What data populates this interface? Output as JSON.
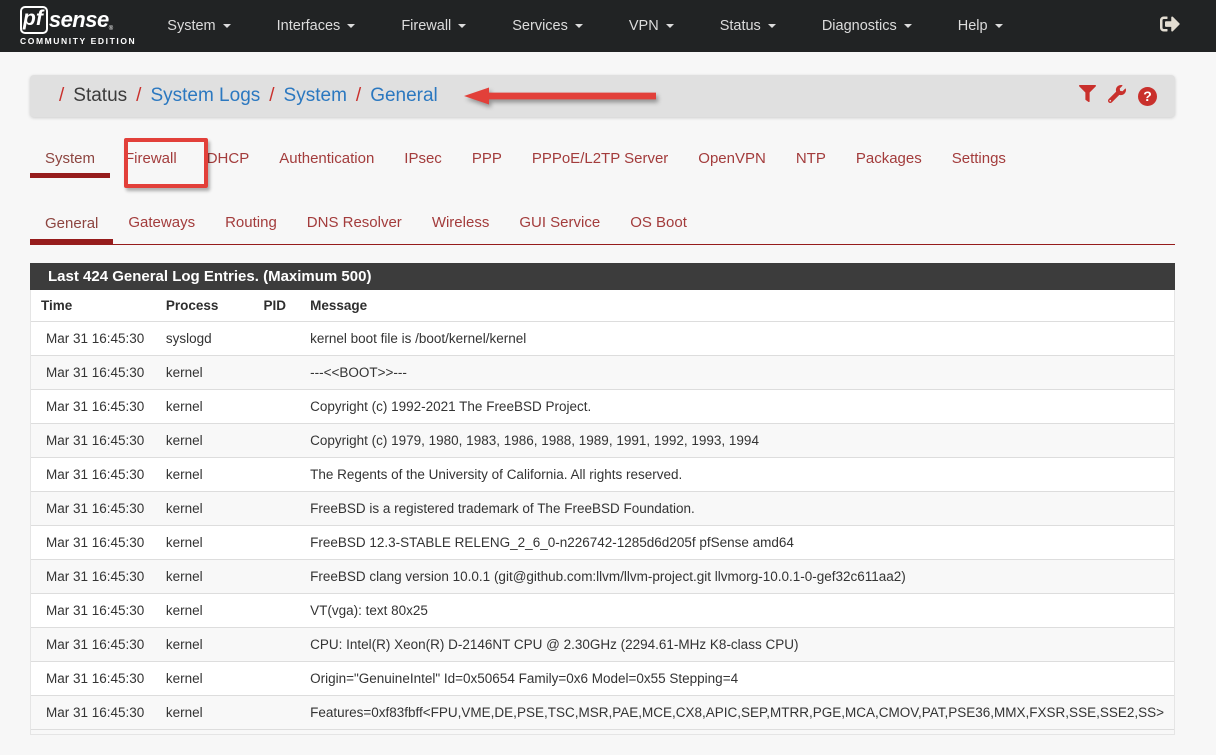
{
  "navbar": {
    "logo": {
      "pf": "pf",
      "sense": "sense",
      "reg": "®",
      "edition": "COMMUNITY EDITION"
    },
    "items": [
      {
        "label": "System"
      },
      {
        "label": "Interfaces"
      },
      {
        "label": "Firewall"
      },
      {
        "label": "Services"
      },
      {
        "label": "VPN"
      },
      {
        "label": "Status"
      },
      {
        "label": "Diagnostics"
      },
      {
        "label": "Help"
      }
    ]
  },
  "breadcrumb": {
    "separator": "/",
    "items": [
      {
        "label": "Status",
        "link": false
      },
      {
        "label": "System Logs",
        "link": true
      },
      {
        "label": "System",
        "link": true
      },
      {
        "label": "General",
        "link": true
      }
    ]
  },
  "header_actions": {
    "icons": [
      "filter-icon",
      "wrench-icon",
      "question-circle-icon"
    ],
    "question_glyph": "?"
  },
  "tabs_primary": [
    {
      "label": "System",
      "active": true
    },
    {
      "label": "Firewall",
      "active": false
    },
    {
      "label": "DHCP",
      "active": false
    },
    {
      "label": "Authentication",
      "active": false
    },
    {
      "label": "IPsec",
      "active": false
    },
    {
      "label": "PPP",
      "active": false
    },
    {
      "label": "PPPoE/L2TP Server",
      "active": false
    },
    {
      "label": "OpenVPN",
      "active": false
    },
    {
      "label": "NTP",
      "active": false
    },
    {
      "label": "Packages",
      "active": false
    },
    {
      "label": "Settings",
      "active": false
    }
  ],
  "tabs_secondary": [
    {
      "label": "General",
      "active": true
    },
    {
      "label": "Gateways",
      "active": false
    },
    {
      "label": "Routing",
      "active": false
    },
    {
      "label": "DNS Resolver",
      "active": false
    },
    {
      "label": "Wireless",
      "active": false
    },
    {
      "label": "GUI Service",
      "active": false
    },
    {
      "label": "OS Boot",
      "active": false
    }
  ],
  "log_panel": {
    "title": "Last 424 General Log Entries. (Maximum 500)",
    "columns": [
      "Time",
      "Process",
      "PID",
      "Message"
    ],
    "rows": [
      {
        "time": "Mar 31 16:45:30",
        "process": "syslogd",
        "pid": "",
        "message": "kernel boot file is /boot/kernel/kernel"
      },
      {
        "time": "Mar 31 16:45:30",
        "process": "kernel",
        "pid": "",
        "message": "---<<BOOT>>---"
      },
      {
        "time": "Mar 31 16:45:30",
        "process": "kernel",
        "pid": "",
        "message": "Copyright (c) 1992-2021 The FreeBSD Project."
      },
      {
        "time": "Mar 31 16:45:30",
        "process": "kernel",
        "pid": "",
        "message": "Copyright (c) 1979, 1980, 1983, 1986, 1988, 1989, 1991, 1992, 1993, 1994"
      },
      {
        "time": "Mar 31 16:45:30",
        "process": "kernel",
        "pid": "",
        "message": "The Regents of the University of California. All rights reserved."
      },
      {
        "time": "Mar 31 16:45:30",
        "process": "kernel",
        "pid": "",
        "message": "FreeBSD is a registered trademark of The FreeBSD Foundation."
      },
      {
        "time": "Mar 31 16:45:30",
        "process": "kernel",
        "pid": "",
        "message": "FreeBSD 12.3-STABLE RELENG_2_6_0-n226742-1285d6d205f pfSense amd64"
      },
      {
        "time": "Mar 31 16:45:30",
        "process": "kernel",
        "pid": "",
        "message": "FreeBSD clang version 10.0.1 (git@github.com:llvm/llvm-project.git llvmorg-10.0.1-0-gef32c611aa2)"
      },
      {
        "time": "Mar 31 16:45:30",
        "process": "kernel",
        "pid": "",
        "message": "VT(vga): text 80x25"
      },
      {
        "time": "Mar 31 16:45:30",
        "process": "kernel",
        "pid": "",
        "message": "CPU: Intel(R) Xeon(R) D-2146NT CPU @ 2.30GHz (2294.61-MHz K8-class CPU)"
      },
      {
        "time": "Mar 31 16:45:30",
        "process": "kernel",
        "pid": "",
        "message": "Origin=\"GenuineIntel\" Id=0x50654 Family=0x6 Model=0x55 Stepping=4"
      },
      {
        "time": "Mar 31 16:45:30",
        "process": "kernel",
        "pid": "",
        "message": "Features=0xf83fbff<FPU,VME,DE,PSE,TSC,MSR,PAE,MCE,CX8,APIC,SEP,MTRR,PGE,MCA,CMOV,PAT,PSE36,MMX,FXSR,SSE,SSE2,SS>"
      }
    ]
  },
  "colors": {
    "navbar_bg": "#212324",
    "breadcrumb_bg": "#e0e0e0",
    "link_blue": "#2b78c0",
    "accent_red": "#c9302c",
    "tab_red": "#a33c3c",
    "tab_underline": "#961c1c",
    "panel_header_bg": "#3c3c3c",
    "annotation_red": "#e2403a"
  }
}
